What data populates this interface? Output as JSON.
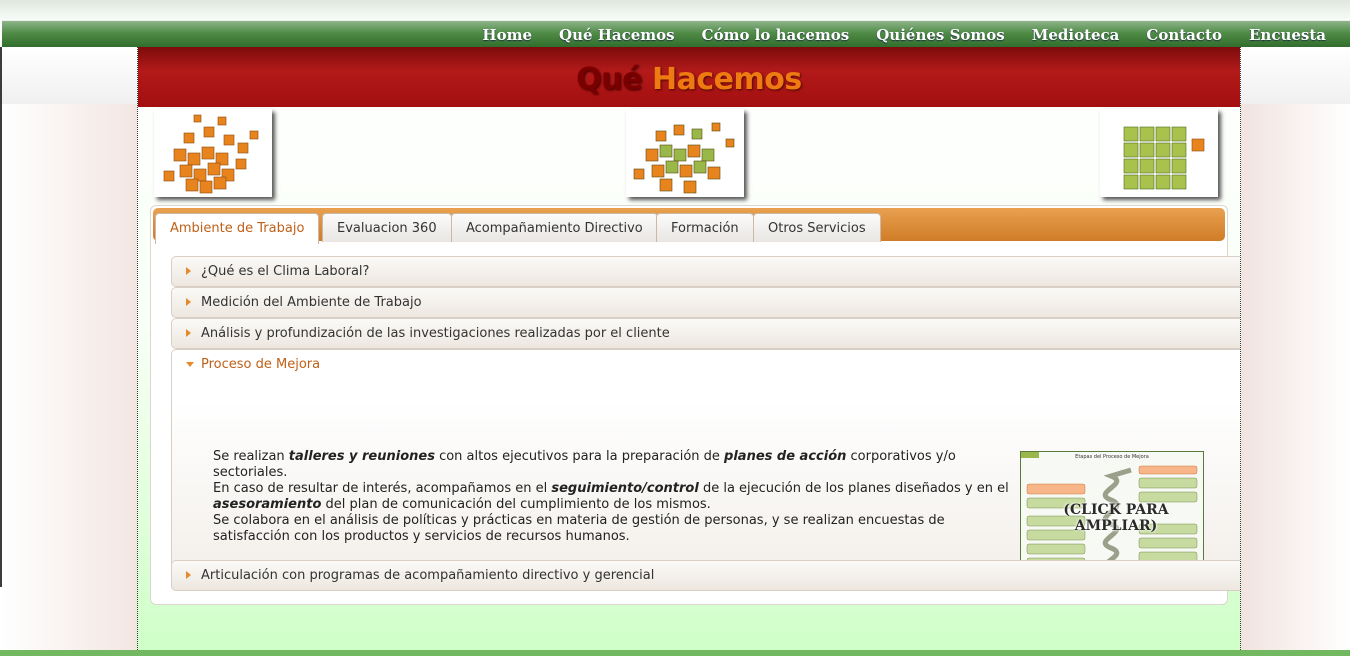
{
  "nav": {
    "items": [
      "Home",
      "Qué Hacemos",
      "Cómo lo hacemos",
      "Quiénes Somos",
      "Medioteca",
      "Contacto",
      "Encuesta"
    ]
  },
  "banner": {
    "word1": "Qué",
    "word2": "Hacemos"
  },
  "tabs": [
    "Ambiente de Trabajo",
    "Evaluacion 360",
    "Acompañamiento Directivo",
    "Formación",
    "Otros Servicios"
  ],
  "active_tab": "Ambiente de Trabajo",
  "accordion": [
    "¿Qué es el Clima Laboral?",
    "Medición del Ambiente de Trabajo",
    "Análisis y profundización de las investigaciones realizadas por el cliente",
    "Proceso de Mejora",
    "Articulación con programas de acompañamiento directivo y gerencial"
  ],
  "open_section": "Proceso de Mejora",
  "panel": {
    "p1_a": "Se realizan ",
    "p1_b": "talleres y reuniones",
    "p1_c": " con altos ejecutivos para la preparación de ",
    "p1_d": "planes de acción",
    "p1_e": " corporativos y/o sectoriales.",
    "p2_a": "En caso de resultar de interés, acompañamos en el ",
    "p2_b": "seguimiento/control",
    "p2_c": " de la ejecución de los planes diseñados y en el ",
    "p2_d": "asesoramiento",
    "p2_e": " del plan de comunicación del cumplimiento de los mismos.",
    "p3": "Se colabora en el análisis de políticas y prácticas en materia de gestión de personas, y se realizan encuestas de satisfacción con los productos y servicios de recursos humanos.",
    "thumb_title": "Etapas del Proceso de Mejora",
    "thumb_caption": "(CLICK PARA AMPLIAR)"
  },
  "colors": {
    "nav_green": "#4f8b47",
    "banner_red": "#a30e0e",
    "accent_orange": "#e58a2a",
    "active_tab_text": "#c06018"
  }
}
